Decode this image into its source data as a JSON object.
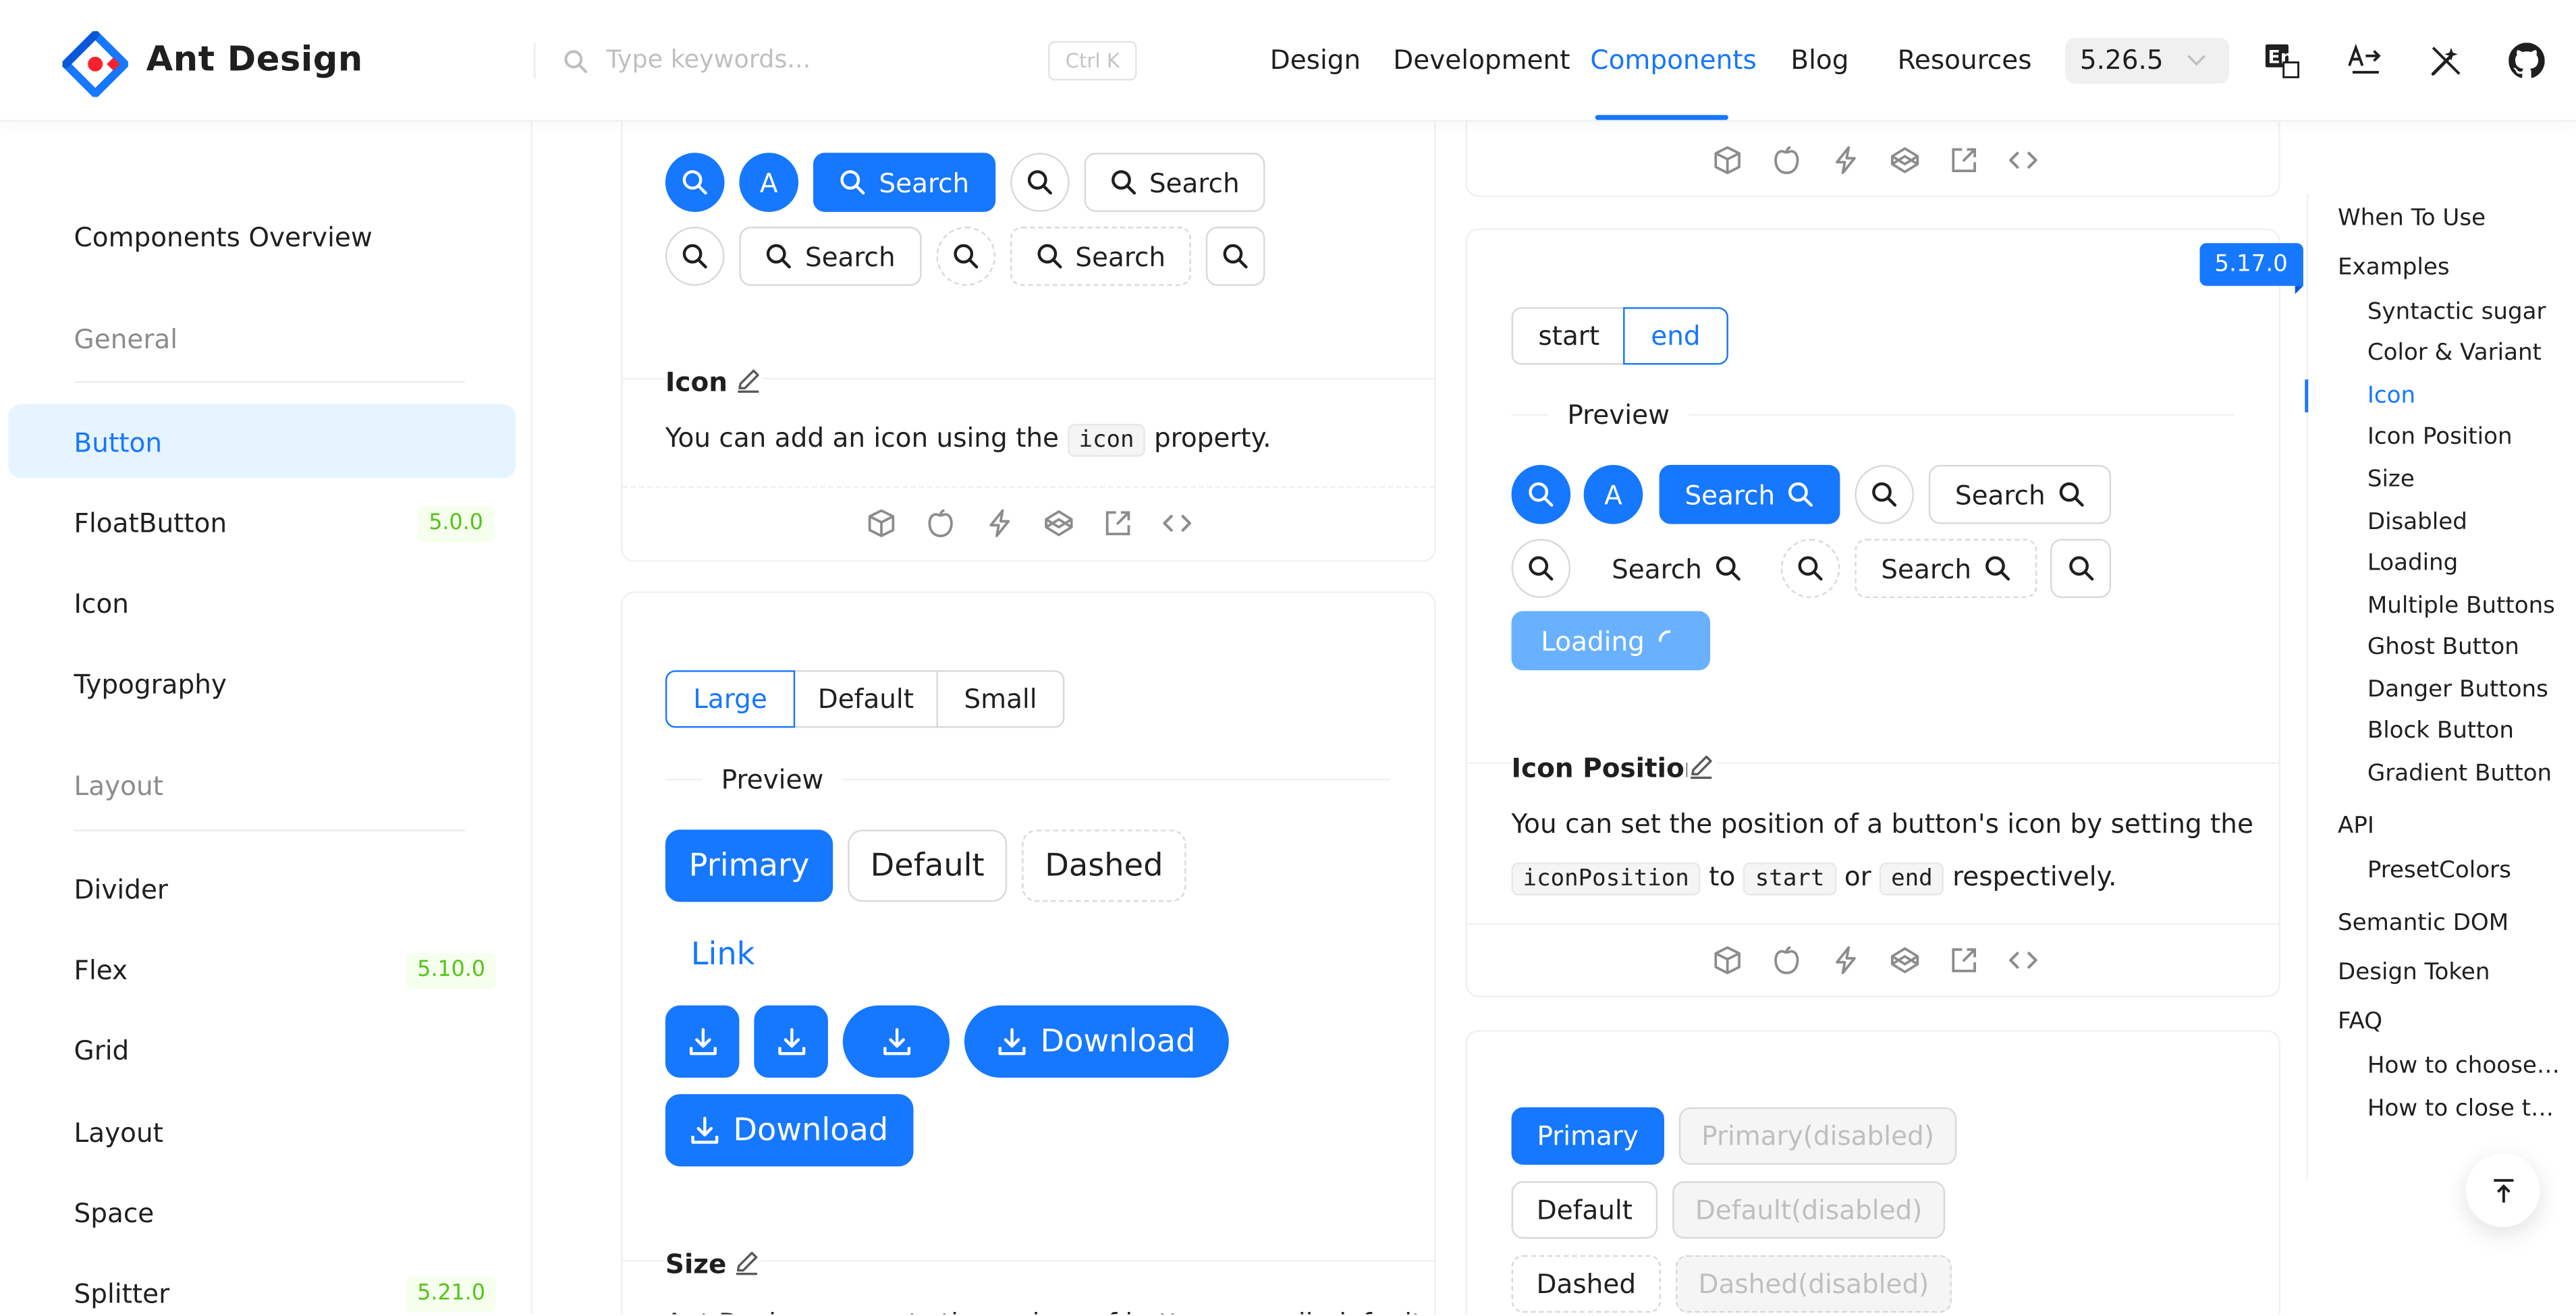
{
  "app": {
    "name": "Ant Design"
  },
  "header": {
    "search_placeholder": "Type keywords...",
    "shortcut": "Ctrl K",
    "nav": [
      "Design",
      "Development",
      "Components",
      "Blog",
      "Resources"
    ],
    "active_nav": "Components",
    "version": "5.26.5",
    "icons": [
      "translate-en-icon",
      "direction-icon",
      "theme-icon",
      "github-icon"
    ]
  },
  "sidebar": {
    "overview": "Components Overview",
    "group_general": "General",
    "general": [
      {
        "label": "Button",
        "active": true
      },
      {
        "label": "FloatButton",
        "tag": "5.0.0"
      },
      {
        "label": "Icon"
      },
      {
        "label": "Typography"
      }
    ],
    "group_layout": "Layout",
    "layout": [
      {
        "label": "Divider"
      },
      {
        "label": "Flex",
        "tag": "5.10.0"
      },
      {
        "label": "Grid"
      },
      {
        "label": "Layout"
      },
      {
        "label": "Space"
      },
      {
        "label": "Splitter",
        "tag": "5.21.0"
      }
    ]
  },
  "left": {
    "search_label": "Search",
    "a_label": "A",
    "icon_demo": {
      "title": "Icon",
      "desc_before": "You can add an icon using the ",
      "code": "icon",
      "desc_after": " property."
    },
    "size_demo": {
      "seg": [
        "Large",
        "Default",
        "Small"
      ],
      "preview": "Preview",
      "primary": "Primary",
      "default": "Default",
      "dashed": "Dashed",
      "link": "Link",
      "download": "Download",
      "title": "Size",
      "desc": "Ant Design supports three sizes of buttons: small, default and large."
    }
  },
  "right": {
    "version_tag": "5.17.0",
    "seg": [
      "start",
      "end"
    ],
    "preview": "Preview",
    "search_label": "Search",
    "a_label": "A",
    "loading": "Loading",
    "icon_pos": {
      "title": "Icon Position",
      "line1": "You can set the position of a button's icon by setting the",
      "code1": "iconPosition",
      "to": " to ",
      "code2": "start",
      "or": " or ",
      "code3": "end",
      "after": " respectively."
    },
    "disabled_demo": {
      "primary": "Primary",
      "primary_dis": "Primary(disabled)",
      "default": "Default",
      "default_dis": "Default(disabled)",
      "dashed": "Dashed",
      "dashed_dis": "Dashed(disabled)"
    }
  },
  "toc": {
    "when": "When To Use",
    "examples": "Examples",
    "items": [
      "Syntactic sugar",
      "Color & Variant",
      "Icon",
      "Icon Position",
      "Size",
      "Disabled",
      "Loading",
      "Multiple Buttons",
      "Ghost Button",
      "Danger Buttons",
      "Block Button",
      "Gradient Button"
    ],
    "active": "Icon",
    "api": "API",
    "api_items": [
      "PresetColors"
    ],
    "semantic": "Semantic DOM",
    "token": "Design Token",
    "faq": "FAQ",
    "faq_items": [
      "How to choose t...",
      "How to close the..."
    ]
  },
  "colors": {
    "primary": "#1677ff",
    "tag_green": "#52c41a",
    "active_bg": "#e6f4ff"
  }
}
